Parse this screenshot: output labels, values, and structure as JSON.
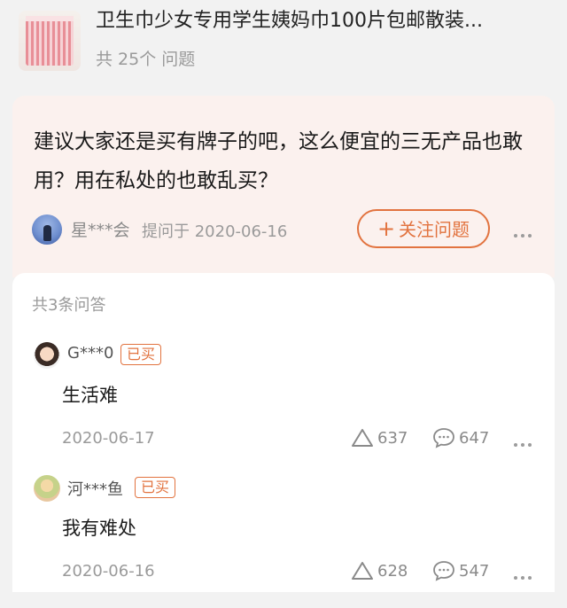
{
  "product": {
    "title": "卫生巾少女专用学生姨妈巾100片包邮散装...",
    "question_count": "共 25个 问题"
  },
  "question": {
    "text": "建议大家还是买有牌子的吧，这么便宜的三无产品也敢用？用在私处的也敢乱买？",
    "asker_name": "星***会",
    "asked_meta": "提问于 2020-06-16",
    "follow_label": "关注问题",
    "follow_icon": "plus-icon"
  },
  "answers_section": {
    "count_label": "共3条问答",
    "answers": [
      {
        "user": "G***0",
        "tag": "已买",
        "text": "生活难",
        "date": "2020-06-17",
        "likes": "637",
        "comments": "647"
      },
      {
        "user": "河***鱼",
        "tag": "已买",
        "text": "我有难处",
        "date": "2020-06-16",
        "likes": "628",
        "comments": "547"
      }
    ]
  },
  "colors": {
    "accent": "#e2733f",
    "question_bg": "#fbf1ee",
    "page_bg": "#f2f2f2"
  }
}
